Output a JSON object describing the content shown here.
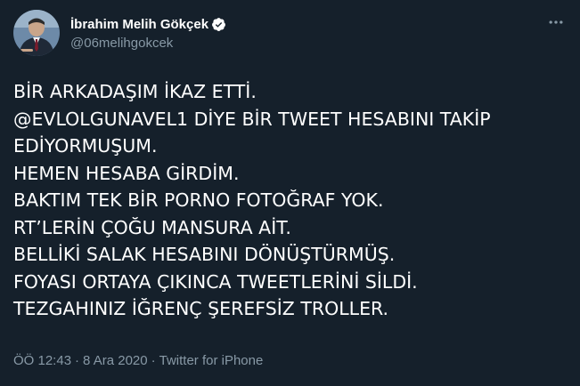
{
  "colors": {
    "background": "#15202b",
    "text": "#ffffff",
    "secondary_text": "#8899a6",
    "verified_badge": "#ffffff"
  },
  "author": {
    "display_name": "İbrahim Melih Gökçek",
    "handle": "@06melihgokcek",
    "verified_icon": "verified-badge-icon",
    "avatar_icon": "profile-avatar"
  },
  "more_icon": "more-options-icon",
  "tweet": {
    "lines": [
      "BİR ARKADAŞIM İKAZ ETTİ.",
      "@EVLOLGUNAVEL1 DİYE BİR TWEET HESABINI TAKİP",
      "EDİYORMUŞUM.",
      "HEMEN HESABA GİRDİM.",
      "BAKTIM TEK BİR PORNO FOTOĞRAF YOK.",
      "RT’LERİN ÇOĞU MANSURA AİT.",
      "BELLİKİ SALAK HESABINI DÖNÜŞTÜRMÜŞ.",
      "FOYASI ORTAYA ÇIKINCA TWEETLERİNİ SİLDİ.",
      "TEZGAHINIZ İĞRENÇ ŞEREFSİZ TROLLER."
    ]
  },
  "meta": {
    "time": "ÖÖ 12:43",
    "separator": "·",
    "date": "8 Ara 2020",
    "source": "Twitter for iPhone"
  }
}
